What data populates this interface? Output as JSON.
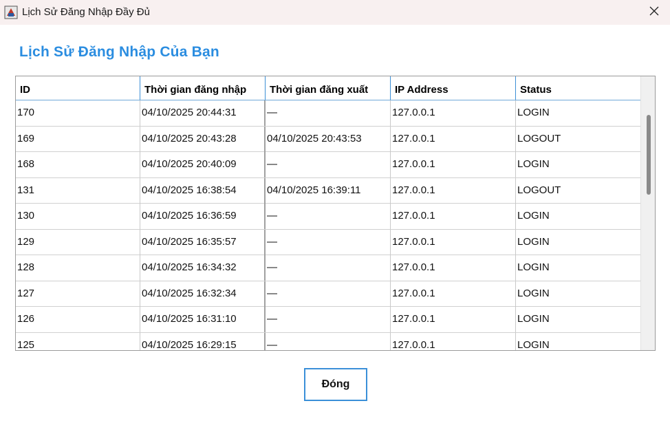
{
  "window": {
    "title": "Lịch Sử Đăng Nhập Đầy Đủ",
    "app_icon": "java-app-icon",
    "close_icon": "close-icon"
  },
  "heading": "Lịch Sử Đăng Nhập Của Bạn",
  "table": {
    "columns": [
      "ID",
      "Thời gian đăng nhập",
      "Thời gian đăng xuất",
      "IP Address",
      "Status"
    ],
    "rows": [
      [
        "170",
        "04/10/2025 20:44:31",
        "—",
        "127.0.0.1",
        "LOGIN"
      ],
      [
        "169",
        "04/10/2025 20:43:28",
        "04/10/2025 20:43:53",
        "127.0.0.1",
        "LOGOUT"
      ],
      [
        "168",
        "04/10/2025 20:40:09",
        "—",
        "127.0.0.1",
        "LOGIN"
      ],
      [
        "131",
        "04/10/2025 16:38:54",
        "04/10/2025 16:39:11",
        "127.0.0.1",
        "LOGOUT"
      ],
      [
        "130",
        "04/10/2025 16:36:59",
        "—",
        "127.0.0.1",
        "LOGIN"
      ],
      [
        "129",
        "04/10/2025 16:35:57",
        "—",
        "127.0.0.1",
        "LOGIN"
      ],
      [
        "128",
        "04/10/2025 16:34:32",
        "—",
        "127.0.0.1",
        "LOGIN"
      ],
      [
        "127",
        "04/10/2025 16:32:34",
        "—",
        "127.0.0.1",
        "LOGIN"
      ],
      [
        "126",
        "04/10/2025 16:31:10",
        "—",
        "127.0.0.1",
        "LOGIN"
      ],
      [
        "125",
        "04/10/2025 16:29:15",
        "—",
        "127.0.0.1",
        "LOGIN"
      ]
    ]
  },
  "footer": {
    "close_label": "Đóng"
  },
  "colors": {
    "heading": "#2b8de0",
    "header_border": "#3c8fd6",
    "button_border": "#3a8fd8",
    "titlebar": "#f8f0f0"
  }
}
